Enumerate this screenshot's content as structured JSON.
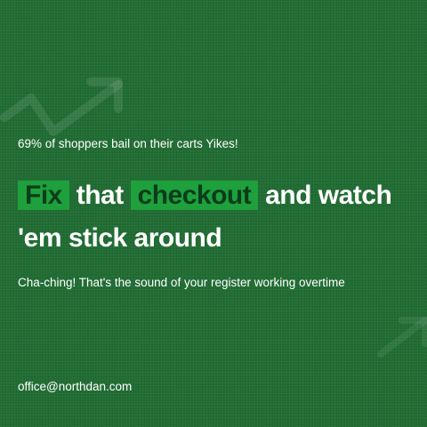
{
  "card": {
    "stat_text": "69% of shoppers bail on their carts Yikes!",
    "headline": {
      "word1": "Fix",
      "word2": "that",
      "word3": "checkout",
      "rest_line1": "and watch",
      "line2": "'em stick around"
    },
    "tagline": "Cha-ching! That's the sound of your register working overtime",
    "email": "office@northdan.com"
  },
  "colors": {
    "background": "#1f6b32",
    "highlight": "#1ea03c",
    "highlight_text": "#0b3d1b",
    "text": "#ffffff"
  },
  "icons": [
    "trend-arrow-icon",
    "trend-arrow-icon"
  ]
}
